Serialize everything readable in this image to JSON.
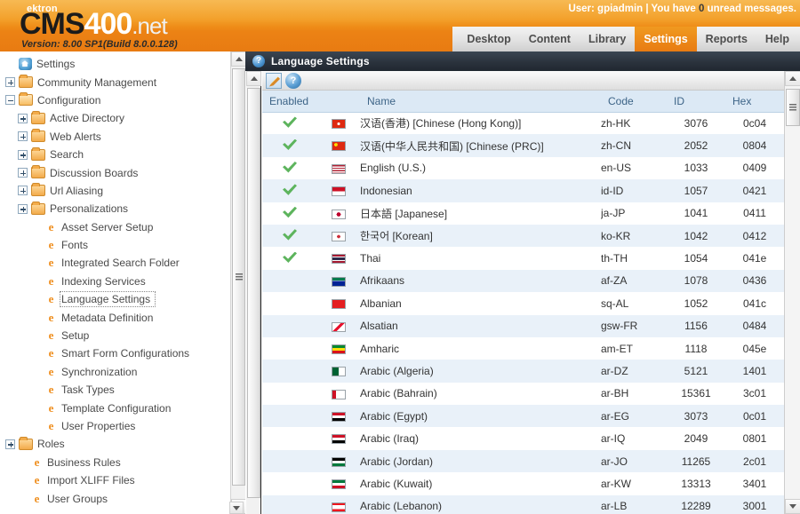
{
  "branding": {
    "ektron": "ektron",
    "cms": "CMS",
    "four_hundred": "400",
    "dotnet": ".net",
    "version": "Version: 8.00 SP1(Build 8.0.0.128)",
    "accent_orange": "#e87b12",
    "accent_orange_light": "#f5a623"
  },
  "header": {
    "user_label": "User: gpiadmin | You have ",
    "unread_count": "0",
    "unread_suffix": " unread messages.",
    "tabs": [
      {
        "label": "Desktop",
        "active": false
      },
      {
        "label": "Content",
        "active": false
      },
      {
        "label": "Library",
        "active": false
      },
      {
        "label": "Settings",
        "active": true
      },
      {
        "label": "Reports",
        "active": false
      },
      {
        "label": "Help",
        "active": false
      }
    ]
  },
  "sidebar": {
    "items": [
      {
        "label": "Settings",
        "depth": 0,
        "icon": "home-icon",
        "toggle": "none",
        "selected": false
      },
      {
        "label": "Community Management",
        "depth": 1,
        "icon": "folder-icon",
        "toggle": "plus",
        "selected": false
      },
      {
        "label": "Configuration",
        "depth": 1,
        "icon": "folder-open-icon",
        "toggle": "minus",
        "selected": false
      },
      {
        "label": "Active Directory",
        "depth": 2,
        "icon": "folder-icon",
        "toggle": "plus",
        "selected": false
      },
      {
        "label": "Web Alerts",
        "depth": 2,
        "icon": "folder-icon",
        "toggle": "plus",
        "selected": false
      },
      {
        "label": "Search",
        "depth": 2,
        "icon": "folder-icon",
        "toggle": "plus",
        "selected": false
      },
      {
        "label": "Discussion Boards",
        "depth": 2,
        "icon": "folder-icon",
        "toggle": "plus",
        "selected": false
      },
      {
        "label": "Url Aliasing",
        "depth": 2,
        "icon": "folder-icon",
        "toggle": "plus",
        "selected": false
      },
      {
        "label": "Personalizations",
        "depth": 2,
        "icon": "folder-icon",
        "toggle": "plus",
        "selected": false
      },
      {
        "label": "Asset Server Setup",
        "depth": 3,
        "icon": "ektron-e-icon",
        "toggle": "none",
        "selected": false
      },
      {
        "label": "Fonts",
        "depth": 3,
        "icon": "ektron-e-icon",
        "toggle": "none",
        "selected": false
      },
      {
        "label": "Integrated Search Folder",
        "depth": 3,
        "icon": "ektron-e-icon",
        "toggle": "none",
        "selected": false
      },
      {
        "label": "Indexing Services",
        "depth": 3,
        "icon": "ektron-e-icon",
        "toggle": "none",
        "selected": false
      },
      {
        "label": "Language Settings",
        "depth": 3,
        "icon": "ektron-e-icon",
        "toggle": "none",
        "selected": true
      },
      {
        "label": "Metadata Definition",
        "depth": 3,
        "icon": "ektron-e-icon",
        "toggle": "none",
        "selected": false
      },
      {
        "label": "Setup",
        "depth": 3,
        "icon": "ektron-e-icon",
        "toggle": "none",
        "selected": false
      },
      {
        "label": "Smart Form Configurations",
        "depth": 3,
        "icon": "ektron-e-icon",
        "toggle": "none",
        "selected": false
      },
      {
        "label": "Synchronization",
        "depth": 3,
        "icon": "ektron-e-icon",
        "toggle": "none",
        "selected": false
      },
      {
        "label": "Task Types",
        "depth": 3,
        "icon": "ektron-e-icon",
        "toggle": "none",
        "selected": false
      },
      {
        "label": "Template Configuration",
        "depth": 3,
        "icon": "ektron-e-icon",
        "toggle": "none",
        "selected": false
      },
      {
        "label": "User Properties",
        "depth": 3,
        "icon": "ektron-e-icon",
        "toggle": "none",
        "selected": false
      },
      {
        "label": "Roles",
        "depth": 1,
        "icon": "folder-icon",
        "toggle": "plus",
        "selected": false
      },
      {
        "label": "Business Rules",
        "depth": 2,
        "icon": "ektron-e-icon",
        "toggle": "none",
        "selected": false
      },
      {
        "label": "Import XLIFF Files",
        "depth": 2,
        "icon": "ektron-e-icon",
        "toggle": "none",
        "selected": false
      },
      {
        "label": "User Groups",
        "depth": 2,
        "icon": "ektron-e-icon",
        "toggle": "none",
        "selected": false
      }
    ]
  },
  "page": {
    "title": "Language Settings",
    "title_icon": "help-circle-icon",
    "toolbar": [
      {
        "name": "edit-button",
        "icon": "pencil-edit-icon",
        "label": ""
      },
      {
        "name": "help-button",
        "icon": "help-circle-icon",
        "label": "?"
      }
    ]
  },
  "table": {
    "columns": [
      "Enabled",
      "Name",
      "Code",
      "ID",
      "Hex"
    ],
    "rows": [
      {
        "enabled": true,
        "flag": "hk",
        "name": "汉语(香港) [Chinese (Hong Kong)]",
        "code": "zh-HK",
        "id": "3076",
        "hex": "0c04"
      },
      {
        "enabled": true,
        "flag": "cn",
        "name": "汉语(中华人民共和国) [Chinese (PRC)]",
        "code": "zh-CN",
        "id": "2052",
        "hex": "0804"
      },
      {
        "enabled": true,
        "flag": "us",
        "name": "English (U.S.)",
        "code": "en-US",
        "id": "1033",
        "hex": "0409"
      },
      {
        "enabled": true,
        "flag": "id",
        "name": "Indonesian",
        "code": "id-ID",
        "id": "1057",
        "hex": "0421"
      },
      {
        "enabled": true,
        "flag": "jp",
        "name": "日本語 [Japanese]",
        "code": "ja-JP",
        "id": "1041",
        "hex": "0411"
      },
      {
        "enabled": true,
        "flag": "kr",
        "name": "한국어 [Korean]",
        "code": "ko-KR",
        "id": "1042",
        "hex": "0412"
      },
      {
        "enabled": true,
        "flag": "th",
        "name": "Thai",
        "code": "th-TH",
        "id": "1054",
        "hex": "041e"
      },
      {
        "enabled": false,
        "flag": "za",
        "name": "Afrikaans",
        "code": "af-ZA",
        "id": "1078",
        "hex": "0436"
      },
      {
        "enabled": false,
        "flag": "al",
        "name": "Albanian",
        "code": "sq-AL",
        "id": "1052",
        "hex": "041c"
      },
      {
        "enabled": false,
        "flag": "als",
        "name": "Alsatian",
        "code": "gsw-FR",
        "id": "1156",
        "hex": "0484"
      },
      {
        "enabled": false,
        "flag": "et",
        "name": "Amharic",
        "code": "am-ET",
        "id": "1118",
        "hex": "045e"
      },
      {
        "enabled": false,
        "flag": "dz",
        "name": "Arabic (Algeria)",
        "code": "ar-DZ",
        "id": "5121",
        "hex": "1401"
      },
      {
        "enabled": false,
        "flag": "bh",
        "name": "Arabic (Bahrain)",
        "code": "ar-BH",
        "id": "15361",
        "hex": "3c01"
      },
      {
        "enabled": false,
        "flag": "eg",
        "name": "Arabic (Egypt)",
        "code": "ar-EG",
        "id": "3073",
        "hex": "0c01"
      },
      {
        "enabled": false,
        "flag": "iq",
        "name": "Arabic (Iraq)",
        "code": "ar-IQ",
        "id": "2049",
        "hex": "0801"
      },
      {
        "enabled": false,
        "flag": "jo",
        "name": "Arabic (Jordan)",
        "code": "ar-JO",
        "id": "11265",
        "hex": "2c01"
      },
      {
        "enabled": false,
        "flag": "kw",
        "name": "Arabic (Kuwait)",
        "code": "ar-KW",
        "id": "13313",
        "hex": "3401"
      },
      {
        "enabled": false,
        "flag": "lb",
        "name": "Arabic (Lebanon)",
        "code": "ar-LB",
        "id": "12289",
        "hex": "3001"
      }
    ]
  },
  "flag_styles": {
    "hk": "linear-gradient(180deg,#de2910,#de2910)",
    "cn": "linear-gradient(180deg,#de2910,#de2910)",
    "us": "repeating-linear-gradient(180deg,#b22234 0 1.4px,#ffffff 1.4px 2.8px)",
    "id": "linear-gradient(180deg,#ce1126 0 50%,#ffffff 50% 100%)",
    "jp": "#ffffff",
    "kr": "#ffffff",
    "th": "linear-gradient(180deg,#a51931 0 20%,#ffffff 20% 35%,#2d2a4a 35% 65%,#ffffff 65% 80%,#a51931 80% 100%)",
    "za": "linear-gradient(180deg,#007a4d 0 33%,#ffffff 33% 40%,#002395 40% 100%)",
    "al": "linear-gradient(180deg,#e41e20,#e41e20)",
    "als": "linear-gradient(135deg,#ffffff 0 40%,#e8112d 40% 60%,#ffffff 60% 100%)",
    "et": "linear-gradient(180deg,#078930 0 33%,#fcdd09 33% 66%,#da121a 66% 100%)",
    "dz": "linear-gradient(90deg,#006233 0 50%,#ffffff 50% 100%)",
    "bh": "linear-gradient(90deg,#ce1126 0 30%,#ffffff 30% 100%)",
    "eg": "linear-gradient(180deg,#ce1126 0 33%,#ffffff 33% 66%,#000000 66% 100%)",
    "iq": "linear-gradient(180deg,#ce1126 0 33%,#ffffff 33% 66%,#000000 66% 100%)",
    "jo": "linear-gradient(180deg,#000000 0 33%,#ffffff 33% 66%,#007a3d 66% 100%)",
    "kw": "linear-gradient(180deg,#007a3d 0 33%,#ffffff 33% 66%,#ce1126 66% 100%)",
    "lb": "linear-gradient(180deg,#ee161f 0 25%,#ffffff 25% 75%,#ee161f 75% 100%)"
  },
  "scrollbars": {
    "sidebar": {
      "up": "scroll-up-arrow",
      "down": "scroll-down-arrow"
    },
    "content": {
      "up": "scroll-up-arrow",
      "down": "scroll-down-arrow"
    }
  }
}
